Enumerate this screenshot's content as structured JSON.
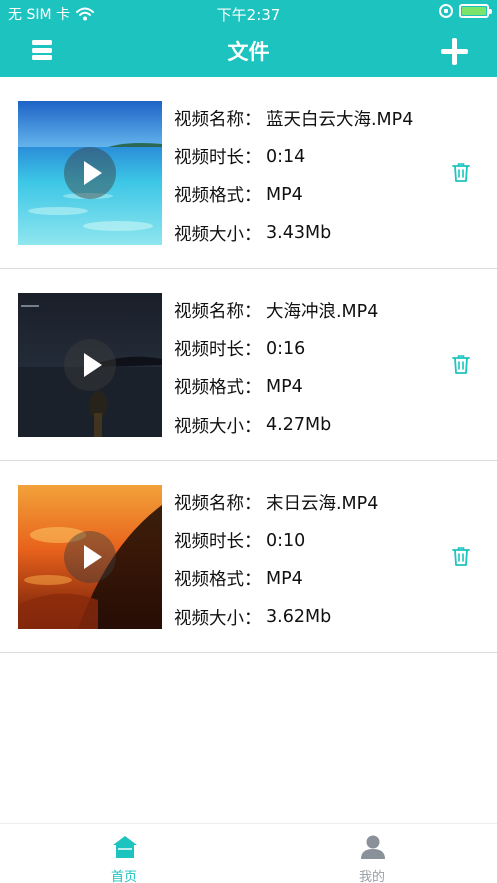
{
  "status_bar": {
    "carrier": "无 SIM 卡",
    "time": "下午2:37",
    "battery_level": 1.0
  },
  "nav": {
    "title": "文件",
    "left_icon": "menu-icon",
    "right_icon": "add-icon"
  },
  "labels": {
    "name": "视频名称：",
    "duration": "视频时长：",
    "format": "视频格式：",
    "size": "视频大小："
  },
  "videos": [
    {
      "name": "蓝天白云大海.MP4",
      "duration": "0:14",
      "format": "MP4",
      "size": "3.43Mb",
      "thumbnail": "sea-under-blue-sky"
    },
    {
      "name": "大海冲浪.MP4",
      "duration": "0:16",
      "format": "MP4",
      "size": "4.27Mb",
      "thumbnail": "dark-night-sea"
    },
    {
      "name": "末日云海.MP4",
      "duration": "0:10",
      "format": "MP4",
      "size": "3.62Mb",
      "thumbnail": "orange-sunset-wave"
    }
  ],
  "tabs": [
    {
      "label": "首页",
      "icon": "home-icon",
      "active": true
    },
    {
      "label": "我的",
      "icon": "user-icon",
      "active": false
    }
  ],
  "colors": {
    "accent": "#1cc3bf",
    "tab_inactive": "#9aa0a6",
    "divider": "#dcdcdc"
  }
}
